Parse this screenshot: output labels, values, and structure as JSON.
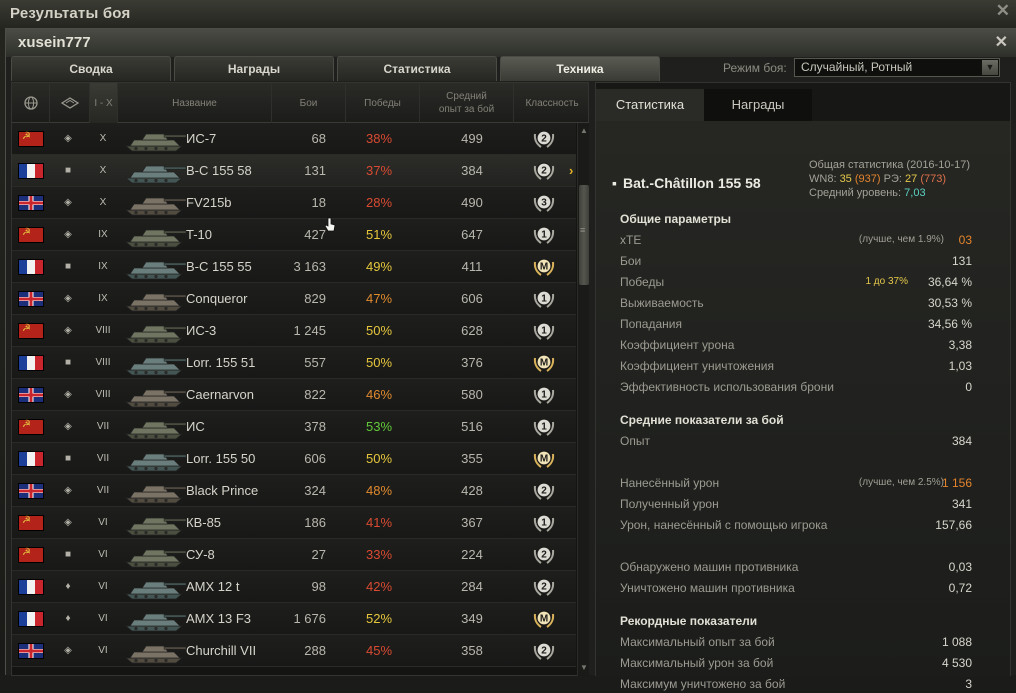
{
  "window": {
    "outer_title": "Результаты боя",
    "player": "xusein777"
  },
  "tabs": [
    {
      "label": "Сводка"
    },
    {
      "label": "Награды"
    },
    {
      "label": "Статистика"
    },
    {
      "label": "Техника"
    }
  ],
  "mode": {
    "label": "Режим боя:",
    "value": "Случайный, Ротный"
  },
  "columns": {
    "tier": "I - X",
    "name": "Название",
    "battles": "Бои",
    "wins": "Победы",
    "avg_xp_line1": "Средний",
    "avg_xp_line2": "опыт за бой",
    "mastery": "Классность"
  },
  "colors": {
    "win_red": "#d94a32",
    "win_orange": "#e08a2e",
    "win_yellow": "#e6c73c",
    "win_green": "#62c93a",
    "accent": "#e6b324"
  },
  "vehicles": [
    {
      "flag": "ussr",
      "type": "td",
      "tier": "X",
      "name": "ИС-7",
      "battles": "68",
      "wins": "38%",
      "win_color": "red",
      "xp": "499",
      "mastery": "2"
    },
    {
      "flag": "france",
      "type": "heavy",
      "tier": "X",
      "name": "B-C 155 58",
      "battles": "131",
      "wins": "37%",
      "win_color": "red",
      "xp": "384",
      "mastery": "2",
      "selected": true
    },
    {
      "flag": "uk",
      "type": "td",
      "tier": "X",
      "name": "FV215b",
      "battles": "18",
      "wins": "28%",
      "win_color": "red",
      "xp": "490",
      "mastery": "3"
    },
    {
      "flag": "ussr",
      "type": "td",
      "tier": "IX",
      "name": "T-10",
      "battles": "427",
      "wins": "51%",
      "win_color": "yellow",
      "xp": "647",
      "mastery": "1"
    },
    {
      "flag": "france",
      "type": "heavy",
      "tier": "IX",
      "name": "B-C 155 55",
      "battles": "3 163",
      "wins": "49%",
      "win_color": "yellow",
      "xp": "411",
      "mastery": "M"
    },
    {
      "flag": "uk",
      "type": "td",
      "tier": "IX",
      "name": "Conqueror",
      "battles": "829",
      "wins": "47%",
      "win_color": "orange",
      "xp": "606",
      "mastery": "1"
    },
    {
      "flag": "ussr",
      "type": "td",
      "tier": "VIII",
      "name": "ИС-3",
      "battles": "1 245",
      "wins": "50%",
      "win_color": "yellow",
      "xp": "628",
      "mastery": "1"
    },
    {
      "flag": "france",
      "type": "heavy",
      "tier": "VIII",
      "name": "Lorr. 155 51",
      "battles": "557",
      "wins": "50%",
      "win_color": "yellow",
      "xp": "376",
      "mastery": "M"
    },
    {
      "flag": "uk",
      "type": "td",
      "tier": "VIII",
      "name": "Caernarvon",
      "battles": "822",
      "wins": "46%",
      "win_color": "orange",
      "xp": "580",
      "mastery": "1"
    },
    {
      "flag": "ussr",
      "type": "td",
      "tier": "VII",
      "name": "ИС",
      "battles": "378",
      "wins": "53%",
      "win_color": "green",
      "xp": "516",
      "mastery": "1"
    },
    {
      "flag": "france",
      "type": "heavy",
      "tier": "VII",
      "name": "Lorr. 155 50",
      "battles": "606",
      "wins": "50%",
      "win_color": "yellow",
      "xp": "355",
      "mastery": "M"
    },
    {
      "flag": "uk",
      "type": "td",
      "tier": "VII",
      "name": "Black Prince",
      "battles": "324",
      "wins": "48%",
      "win_color": "orange",
      "xp": "428",
      "mastery": "2"
    },
    {
      "flag": "ussr",
      "type": "td",
      "tier": "VI",
      "name": "КВ-85",
      "battles": "186",
      "wins": "41%",
      "win_color": "red",
      "xp": "367",
      "mastery": "1"
    },
    {
      "flag": "ussr",
      "type": "heavy",
      "tier": "VI",
      "name": "СУ-8",
      "battles": "27",
      "wins": "33%",
      "win_color": "red",
      "xp": "224",
      "mastery": "2"
    },
    {
      "flag": "france",
      "type": "light",
      "tier": "VI",
      "name": "AMX 12 t",
      "battles": "98",
      "wins": "42%",
      "win_color": "red",
      "xp": "284",
      "mastery": "2"
    },
    {
      "flag": "france",
      "type": "light",
      "tier": "VI",
      "name": "AMX 13 F3",
      "battles": "1 676",
      "wins": "52%",
      "win_color": "yellow",
      "xp": "349",
      "mastery": "M"
    },
    {
      "flag": "uk",
      "type": "td",
      "tier": "VI",
      "name": "Churchill VII",
      "battles": "288",
      "wins": "45%",
      "win_color": "red",
      "xp": "358",
      "mastery": "2"
    }
  ],
  "right": {
    "tabs": [
      "Статистика",
      "Награды"
    ],
    "vehicle": "Bat.-Châtillon 155 58",
    "overall": {
      "title": "Общая статистика (2016-10-17)",
      "wn8_label": "WN8:",
      "wn8": "35",
      "wn8_b": "(937)",
      "re_label": "РЭ:",
      "re": "27",
      "re_b": "(773)",
      "avg_level_label": "Средний уровень:",
      "avg_level": "7,03"
    },
    "general_title": "Общие параметры",
    "general": [
      {
        "label": "xTE",
        "note": "(лучше, чем 1.9%)",
        "value": "03",
        "value_color": "orange"
      },
      {
        "label": "Бои",
        "value": "131"
      },
      {
        "label": "Победы",
        "note2": "1 до 37%",
        "value": "36,64 %"
      },
      {
        "label": "Выживаемость",
        "value": "30,53 %"
      },
      {
        "label": "Попадания",
        "value": "34,56 %"
      },
      {
        "label": "Коэффициент урона",
        "value": "3,38"
      },
      {
        "label": "Коэффициент уничтожения",
        "value": "1,03"
      },
      {
        "label": "Эффективность использования брони",
        "value": "0"
      }
    ],
    "avg_title": "Средние показатели за бой",
    "avg": [
      {
        "label": "Опыт",
        "value": "384"
      },
      {
        "label": "Нанесённый урон",
        "note": "(лучше, чем 2.5%)",
        "value": "1 156",
        "value_color": "orange"
      },
      {
        "label": "Полученный урон",
        "value": "341"
      },
      {
        "label": "Урон, нанесённый с помощью игрока",
        "value": "157,66"
      },
      {
        "label": "Обнаружено машин противника",
        "value": "0,03"
      },
      {
        "label": "Уничтожено машин противника",
        "value": "0,72"
      }
    ],
    "records_title": "Рекордные показатели",
    "records": [
      {
        "label": "Максимальный опыт за бой",
        "value": "1 088"
      },
      {
        "label": "Максимальный урон за бой",
        "value": "4 530"
      },
      {
        "label": "Максимум уничтожено за бой",
        "value": "3"
      }
    ]
  }
}
